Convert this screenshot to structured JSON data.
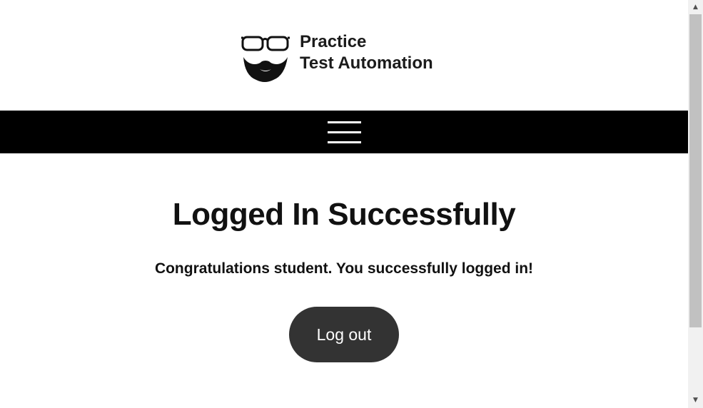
{
  "header": {
    "logo_line1": "Practice",
    "logo_line2": "Test Automation",
    "logo_icon": "glasses-beard-logo-icon"
  },
  "nav": {
    "menu_icon": "hamburger-menu-icon",
    "background_color": "#000000"
  },
  "main": {
    "title": "Logged In Successfully",
    "message": "Congratulations student. You successfully logged in!",
    "logout_label": "Log out",
    "logout_color": "#333333"
  },
  "scrollbar": {
    "up_arrow": "▲",
    "down_arrow": "▼"
  }
}
